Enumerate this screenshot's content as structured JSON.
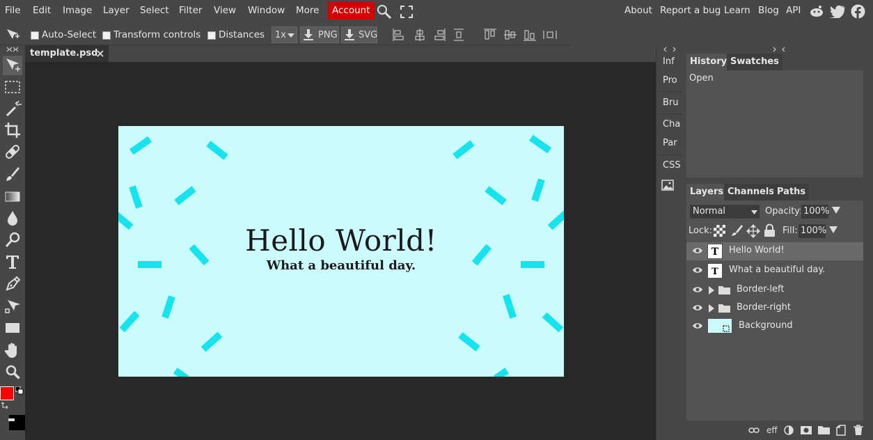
{
  "menu": {
    "items": [
      "File",
      "Edit",
      "Image",
      "Layer",
      "Select",
      "Filter",
      "View",
      "Window",
      "More"
    ],
    "account": "Account",
    "right_links": [
      "About",
      "Report a bug",
      "Learn",
      "Blog",
      "API"
    ]
  },
  "options_bar": {
    "auto_select": "Auto-Select",
    "transform_controls": "Transform controls",
    "distances": "Distances",
    "zoom": "1x",
    "png": "PNG",
    "svg": "SVG"
  },
  "document": {
    "tab_name": "template.psd",
    "title": "Hello World!",
    "subtitle": "What a beautiful day."
  },
  "mini_panels": [
    "Inf",
    "Pro",
    "Bru",
    "Cha",
    "Par",
    "CSS"
  ],
  "history_panel": {
    "tabs": [
      "History",
      "Swatches"
    ],
    "entries": [
      "Open"
    ]
  },
  "layers_panel": {
    "tabs": [
      "Layers",
      "Channels",
      "Paths"
    ],
    "blend_mode": "Normal",
    "opacity_label": "Opacity:",
    "opacity_value": "100%",
    "lock_label": "Lock:",
    "fill_label": "Fill:",
    "fill_value": "100%",
    "layers": [
      {
        "name": "Hello World!",
        "type": "text",
        "selected": true
      },
      {
        "name": "What a beautiful day.",
        "type": "text",
        "selected": false
      },
      {
        "name": "Border-left",
        "type": "folder",
        "selected": false
      },
      {
        "name": "Border-right",
        "type": "folder",
        "selected": false
      },
      {
        "name": "Background",
        "type": "raster",
        "selected": false
      }
    ],
    "footer_eff": "eff"
  },
  "colors": {
    "foreground": "#ff0000",
    "background": "#000000",
    "canvas_bg": "#ccfbfd",
    "confetti": "#15e3ee",
    "account_red": "#d50000"
  }
}
